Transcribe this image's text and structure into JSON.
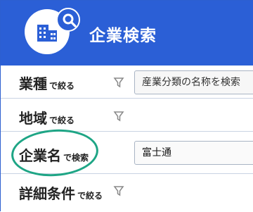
{
  "header": {
    "title": "企業検索",
    "logo_icon": "building-icon",
    "badge_icon": "search-icon",
    "color": "#2b5fd6"
  },
  "filters": [
    {
      "label": "業種",
      "suffix": "で絞る",
      "has_funnel": true,
      "input_placeholder": "産業分類の名称を検索",
      "input_value": ""
    },
    {
      "label": "地域",
      "suffix": "で絞る",
      "has_funnel": true
    },
    {
      "label": "企業名",
      "suffix": "で検索",
      "has_funnel": false,
      "input_value": "富士通",
      "highlighted": true,
      "highlight_color": "#1ea585"
    },
    {
      "label": "詳細条件",
      "suffix": "で絞る",
      "has_funnel": true
    }
  ]
}
